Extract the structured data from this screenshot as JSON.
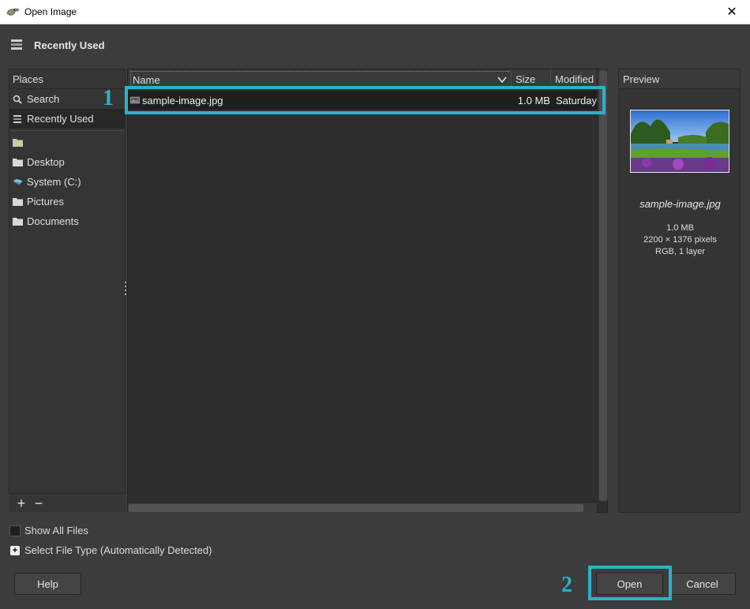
{
  "window": {
    "title": "Open Image",
    "close_label": "✕"
  },
  "location": {
    "label": "Recently Used"
  },
  "places": {
    "header": "Places",
    "items": [
      {
        "label": "Search"
      },
      {
        "label": "Recently Used"
      },
      {
        "label": ""
      },
      {
        "label": "Desktop"
      },
      {
        "label": "System (C:)"
      },
      {
        "label": "Pictures"
      },
      {
        "label": "Documents"
      }
    ],
    "add_label": "+",
    "remove_label": "−"
  },
  "file_list": {
    "columns": {
      "name": "Name",
      "size": "Size",
      "modified": "Modified"
    },
    "rows": [
      {
        "name": "sample-image.jpg",
        "size": "1.0 MB",
        "modified": "Saturday"
      }
    ]
  },
  "preview": {
    "header": "Preview",
    "file_name": "sample-image.jpg",
    "size": "1.0 MB",
    "dimensions": "2200 × 1376 pixels",
    "mode": "RGB, 1 layer"
  },
  "options": {
    "show_all_files": "Show All Files",
    "select_file_type": "Select File Type (Automatically Detected)"
  },
  "buttons": {
    "help": "Help",
    "open": "Open",
    "cancel": "Cancel"
  },
  "annotations": {
    "step1": "1",
    "step2": "2",
    "color": "#2bb1cb"
  }
}
